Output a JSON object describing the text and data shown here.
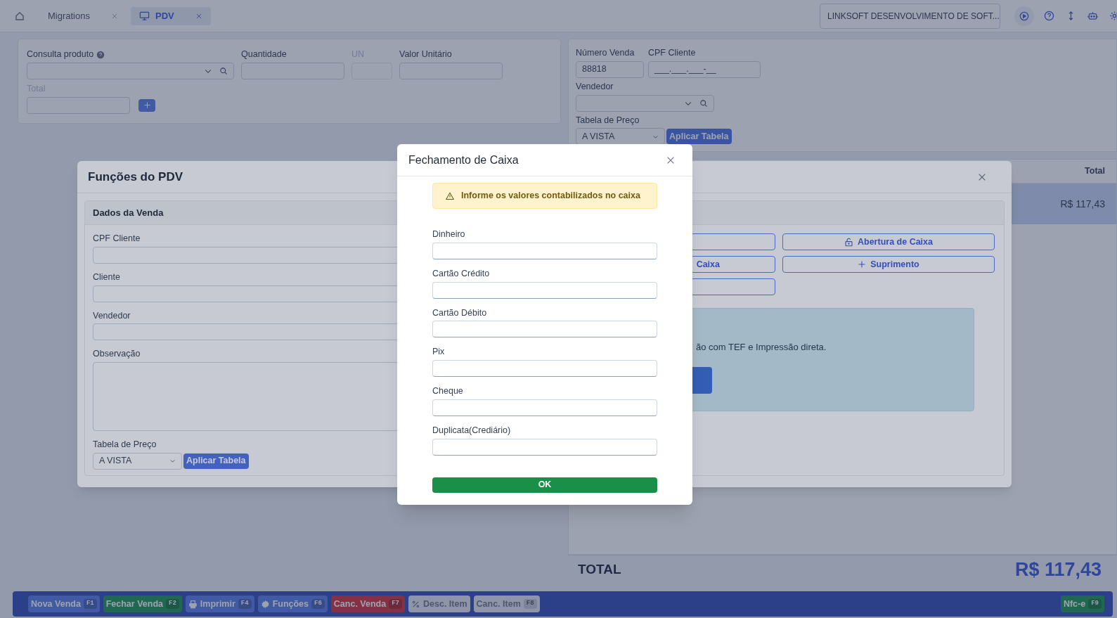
{
  "header": {
    "tabs": [
      {
        "label": "Migrations",
        "selected": false,
        "kind": "plain"
      },
      {
        "label": "PDV",
        "selected": true,
        "kind": "screen"
      }
    ],
    "company_select": "LINKSOFT DESENVOLVIMENTO DE SOFT..."
  },
  "product_form": {
    "fields": [
      {
        "label": "Consulta produto",
        "kind": "search",
        "disabled": false
      },
      {
        "label": "Quantidade",
        "kind": "input",
        "disabled": false
      },
      {
        "label": "UN",
        "kind": "small",
        "disabled": true
      },
      {
        "label": "Valor Unitário",
        "kind": "input",
        "disabled": false
      }
    ],
    "total": {
      "label": "Total",
      "disabled": true
    }
  },
  "sale_form": {
    "number": {
      "label": "Número Venda",
      "value": "88818"
    },
    "cpf": {
      "label": "CPF Cliente",
      "value": "___.___.___-__"
    },
    "seller": {
      "label": "Vendedor"
    },
    "price_table": {
      "label": "Tabela de Preço",
      "value": "A VISTA",
      "button": "Aplicar Tabela"
    }
  },
  "items_table": {
    "columns": [
      "Total"
    ],
    "rows": [
      {
        "total": "R$ 117,43",
        "selected": true
      }
    ]
  },
  "sale_total": {
    "label": "TOTAL",
    "value": "R$ 117,43"
  },
  "toolbar": {
    "buttons": [
      {
        "label": "Nova Venda",
        "key": "F1",
        "kind": "plain",
        "disabled": false
      },
      {
        "label": "Fechar Venda",
        "key": "F2",
        "kind": "plain",
        "disabled": false
      },
      {
        "label": "Imprimir",
        "key": "F4",
        "kind": "printer",
        "disabled": false
      },
      {
        "label": "Funções",
        "key": "F6",
        "kind": "gear",
        "disabled": false
      },
      {
        "label": "Canc. Venda",
        "key": "F7",
        "kind": "plain",
        "disabled": false
      },
      {
        "label": "Desc. Item",
        "kind": "percent",
        "disabled": true
      },
      {
        "label": "Canc. Item",
        "key": "F8",
        "kind": "plain",
        "disabled": true
      }
    ],
    "right_button": {
      "label": "Nfc-e",
      "key": "F9"
    }
  },
  "functions_dialog": {
    "title": "Funções do PDV",
    "sale_card": {
      "title": "Dados da Venda",
      "fields": [
        {
          "label": "CPF Cliente",
          "kind": "input"
        },
        {
          "label": "Cliente",
          "kind": "input"
        },
        {
          "label": "Vendedor",
          "kind": "input"
        },
        {
          "label": "Observação",
          "kind": "textarea"
        }
      ],
      "price_table": {
        "label": "Tabela de Preço",
        "value": "A VISTA",
        "button": "Aplicar Tabela"
      }
    },
    "actions": [
      {
        "kind": "blank"
      },
      {
        "kind": "unlock",
        "label": "Abertura de Caixa"
      },
      {
        "kind": "text",
        "label": "Caixa"
      },
      {
        "kind": "plus",
        "label": "Suprimento"
      },
      {
        "kind": "blank"
      }
    ],
    "info": {
      "text": "ão com TEF e Impressão direta."
    }
  },
  "closing_dialog": {
    "title": "Fechamento de Caixa",
    "alert": "Informe os valores contabilizados no caixa",
    "fields": [
      {
        "label": "Dinheiro"
      },
      {
        "label": "Cartão Crédito"
      },
      {
        "label": "Cartão Débito"
      },
      {
        "label": "Pix"
      },
      {
        "label": "Cheque"
      },
      {
        "label": "Duplicata(Crediário)"
      }
    ],
    "button": "OK"
  }
}
